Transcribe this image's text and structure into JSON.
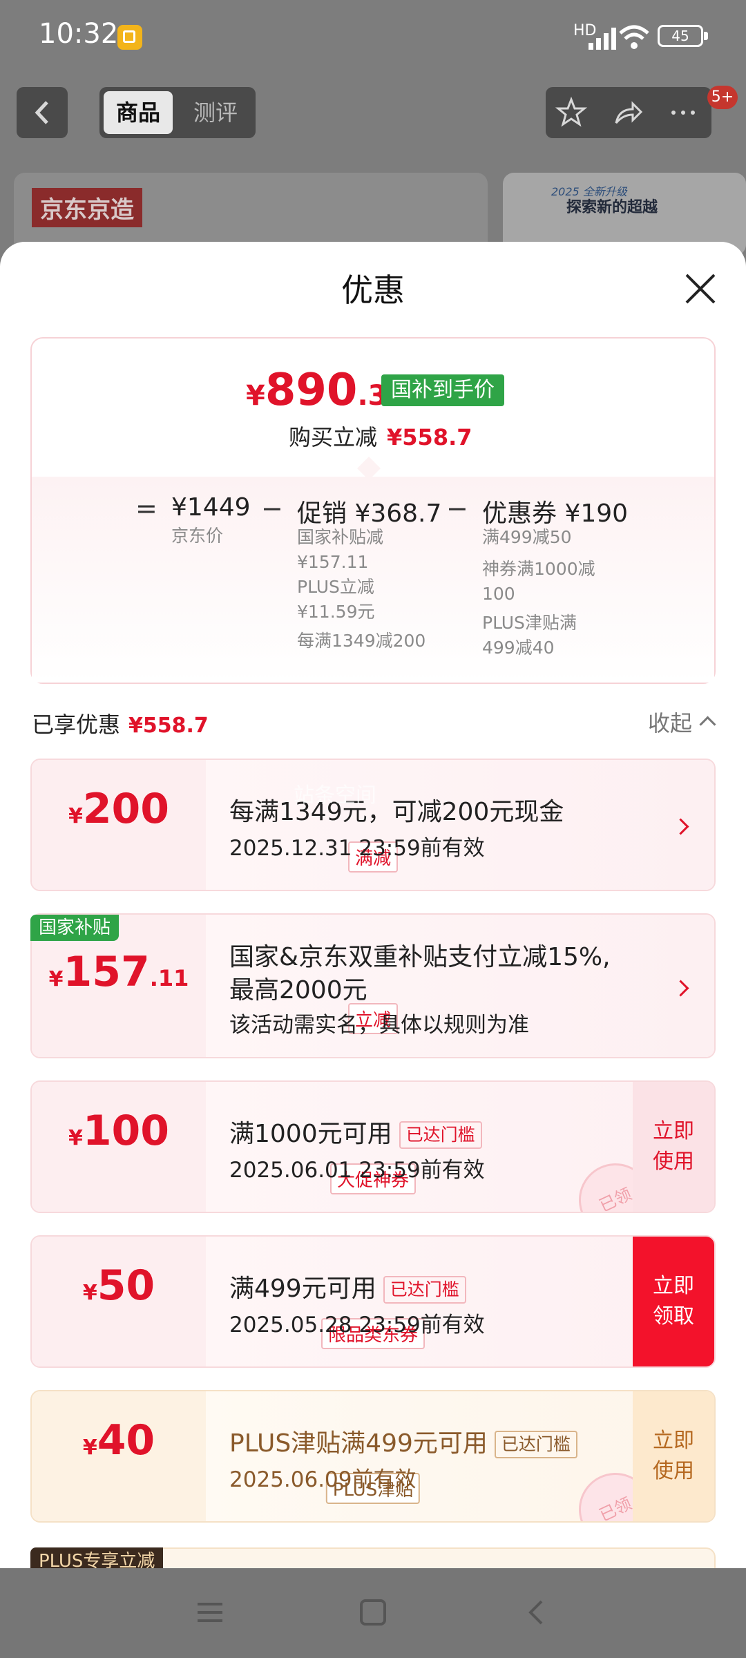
{
  "status_bar": {
    "time": "10:32",
    "network": "HD",
    "battery": "45"
  },
  "header": {
    "tab_active": "商品",
    "tab_other": "测评",
    "badge": "5+"
  },
  "background": {
    "banner_left_logo": "京东京造",
    "banner_right_line1": "2025 全新升级",
    "banner_right_line2": "探索新的超越"
  },
  "sheet": {
    "title": "优惠"
  },
  "summary": {
    "price_symbol": "¥",
    "price_int": "890",
    "price_dec": ".3",
    "price_tag": "国补到手价",
    "buy_label": "购买立减",
    "buy_value": "¥558.7",
    "eq": "=",
    "minus": "−",
    "col1_head": "¥1449",
    "col1_sub": "京东价",
    "col2_head": "促销 ¥368.7",
    "col2_lines": [
      "国家补贴减",
      "¥157.11",
      "PLUS立减",
      "¥11.59元",
      "每满1349减200"
    ],
    "col3_head": "优惠券 ¥190",
    "col3_lines": [
      "满499减50",
      "神券满1000减",
      "100",
      "PLUS津贴满",
      "499减40"
    ]
  },
  "enjoyed": {
    "label": "已享优惠",
    "value": "¥558.7",
    "collapse": "收起"
  },
  "watermark": "站条空间",
  "coupons": [
    {
      "symbol": "¥",
      "amount": "200",
      "decimal": "",
      "chip": "满减",
      "line1": "每满1349元，可减200元现金",
      "line2": "2025.12.31 23:59前有效"
    },
    {
      "flag": "国家补贴",
      "symbol": "¥",
      "amount": "157",
      "decimal": ".11",
      "chip": "立减",
      "line1": "国家&京东双重补贴支付立减15%,",
      "line1b": "最高2000元",
      "line2": "该活动需实名，具体以规则为准"
    },
    {
      "symbol": "¥",
      "amount": "100",
      "decimal": "",
      "chip": "大促神券",
      "line1": "满1000元可用",
      "threshold": "已达门槛",
      "line2": "2025.06.01 23:59前有效",
      "cta": "立即使用",
      "stamp": "已领"
    },
    {
      "symbol": "¥",
      "amount": "50",
      "decimal": "",
      "chip": "限品类东券",
      "line1": "满499元可用",
      "threshold": "已达门槛",
      "line2": "2025.05.28 23:59前有效",
      "cta": "立即领取"
    },
    {
      "symbol": "¥",
      "amount": "40",
      "decimal": "",
      "chip": "PLUS津贴",
      "line1": "PLUS津贴满499元可用",
      "threshold": "已达门槛",
      "line2": "2025.06.09前有效",
      "cta": "立即使用",
      "stamp": "已领"
    }
  ],
  "plus_flag": "PLUS专享立减",
  "colors": {
    "accent_red": "#e0132a",
    "green_tag": "#2fa447",
    "cta_red": "#f3122b",
    "plus_brown": "#8a5a2b"
  }
}
